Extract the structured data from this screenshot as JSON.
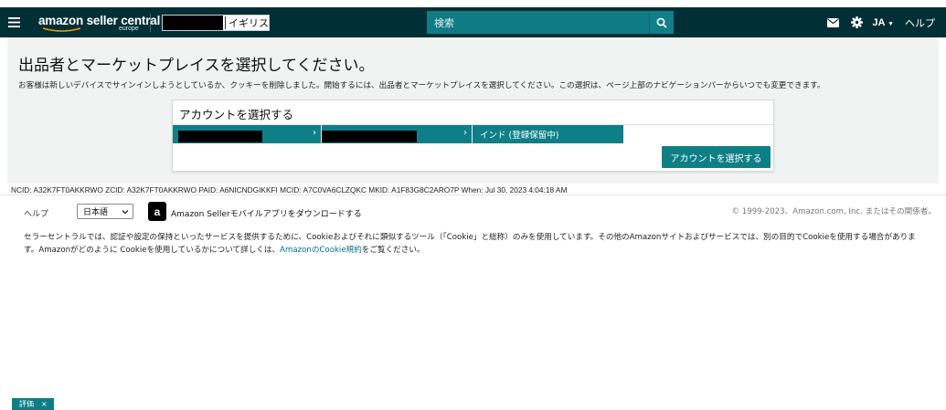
{
  "header": {
    "logo_word": "amazon seller central",
    "logo_region": "europe",
    "store_country": "イギリス",
    "search_placeholder": "検索",
    "language": "JA",
    "help": "ヘルプ"
  },
  "main": {
    "title": "出品者とマーケットプレイスを選択してください。",
    "description": "お客様は新しいデバイスでサインインしようとしているか、クッキーを削除しました。開始するには、出品者とマーケットプレイスを選択してください。この選択は、ページ上部のナビゲーションバーからいつでも変更できます。",
    "account_card": {
      "heading": "アカウントを選択する",
      "crumbs": [
        "",
        "",
        "インド (登録保留中)"
      ],
      "select_button": "アカウントを選択する"
    }
  },
  "ids_line": "NCID: A32K7FT0AKKRWO ZCID: A32K7FT0AKKRWO PAID: A6NICNDGIKKFI MCID: A7C0VA6CLZQKC MKID: A1F83G8C2ARO7P When: Jul 30, 2023 4:04:18 AM",
  "footer": {
    "help": "ヘルプ",
    "language_selected": "日本語",
    "app_text": "Amazon Sellerモバイルアプリをダウンロードする",
    "copyright": "© 1999-2023、Amazon.com, Inc. またはその関係者。",
    "cookie_text_1": "セラーセントラルでは、認証や設定の保持といったサービスを提供するために、Cookieおよびそれに類似するツール（「Cookie」と総称）のみを使用しています。その他のAmazonサイトおよびサービスでは、別の目的でCookieを使用する場合があります。Amazonがどのように Cookieを使用しているかについて詳しくは、",
    "cookie_link": "AmazonのCookie規約",
    "cookie_text_2": "をご覧ください。"
  },
  "feedback": {
    "label": "評価",
    "close": "×"
  },
  "colors": {
    "topbar": "#002f36",
    "teal": "#0f7f87",
    "panel_bg": "#f1f3f3"
  },
  "icons": [
    "menu-icon",
    "search-icon",
    "mail-icon",
    "gear-icon",
    "chevron-down-icon",
    "chevron-right-icon",
    "close-icon"
  ]
}
